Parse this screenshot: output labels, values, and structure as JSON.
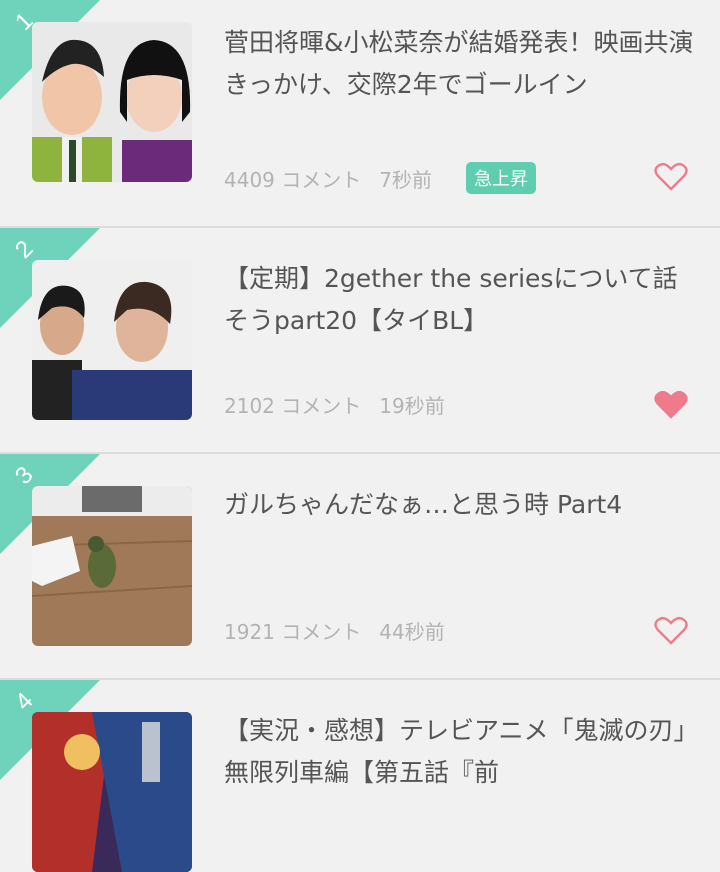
{
  "colors": {
    "rank_bg": "#6fd3bb",
    "badge_bg": "#5fcdb0",
    "heart": "#ef7a8a",
    "meta": "#b3b3b3"
  },
  "items": [
    {
      "rank": "1",
      "title": "菅田将暉&小松菜奈が結婚発表！映画共演きっかけ、交際2年でゴールイン",
      "comments": "4409 コメント",
      "time": "7秒前",
      "badge": "急上昇",
      "favorited": false,
      "thumbnail": "photo of a man in a green suit and a woman with dark bangs"
    },
    {
      "rank": "2",
      "title": "【定期】2gether the seriesについて話そうpart20【タイBL】",
      "comments": "2102 コメント",
      "time": "19秒前",
      "badge": "",
      "favorited": true,
      "thumbnail": "photo of two young men"
    },
    {
      "rank": "3",
      "title": "ガルちゃんだなぁ…と思う時 Part4",
      "comments": "1921 コメント",
      "time": "44秒前",
      "badge": "",
      "favorited": false,
      "thumbnail": "parrot on a wooden floor"
    },
    {
      "rank": "4",
      "title": "【実況・感想】テレビアニメ「鬼滅の刃」無限列車編【第五話『前",
      "comments": "",
      "time": "",
      "badge": "",
      "favorited": false,
      "thumbnail": "anime artwork poster"
    }
  ]
}
